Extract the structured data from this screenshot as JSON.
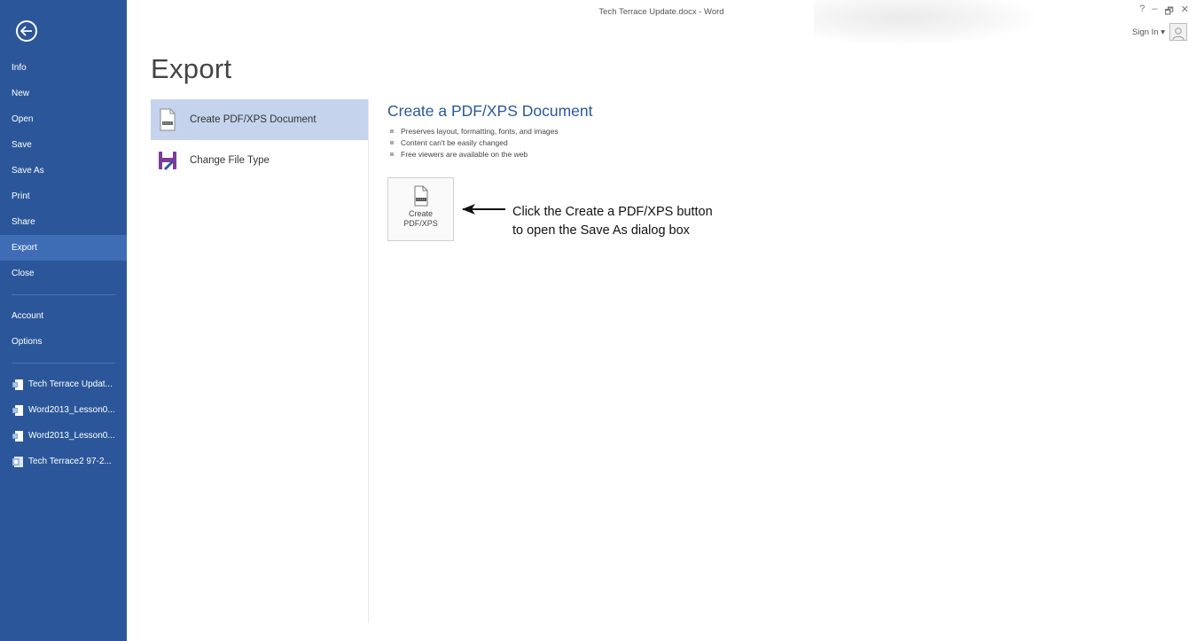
{
  "window": {
    "title": "Tech Terrace Update.docx - Word",
    "controls": [
      "?",
      "–",
      "🗗",
      "✕"
    ],
    "signin_label": "Sign In ▾"
  },
  "nav": {
    "back_icon": "back-arrow-icon",
    "items": [
      {
        "label": "Info"
      },
      {
        "label": "New"
      },
      {
        "label": "Open"
      },
      {
        "label": "Save"
      },
      {
        "label": "Save As"
      },
      {
        "label": "Print"
      },
      {
        "label": "Share"
      },
      {
        "label": "Export"
      },
      {
        "label": "Close"
      }
    ],
    "secondary": [
      {
        "label": "Account"
      },
      {
        "label": "Options"
      }
    ],
    "recent": [
      {
        "label": "Tech Terrace Updat...",
        "icon": "word-doc-icon"
      },
      {
        "label": "Word2013_Lesson0...",
        "icon": "word-doc-icon"
      },
      {
        "label": "Word2013_Lesson0...",
        "icon": "word-doc-icon"
      },
      {
        "label": "Tech Terrace2 97-2...",
        "icon": "word97-doc-icon"
      }
    ],
    "colors": {
      "background": "#2b579a",
      "active": "#3e6db5"
    }
  },
  "export": {
    "page_title": "Export",
    "options": [
      {
        "label": "Create PDF/XPS Document",
        "icon": "pdf-document-icon",
        "selected": true
      },
      {
        "label": "Change File Type",
        "icon": "change-file-type-icon",
        "selected": false
      }
    ],
    "detail": {
      "title": "Create a PDF/XPS Document",
      "bullets": [
        "Preserves layout, formatting, fonts, and images",
        "Content can't be easily changed",
        "Free viewers are available on the web"
      ],
      "button_label": "Create\nPDF/XPS"
    },
    "callout": {
      "line1": "Click the Create a PDF/XPS button",
      "line2": "to open the Save As dialog box"
    }
  }
}
